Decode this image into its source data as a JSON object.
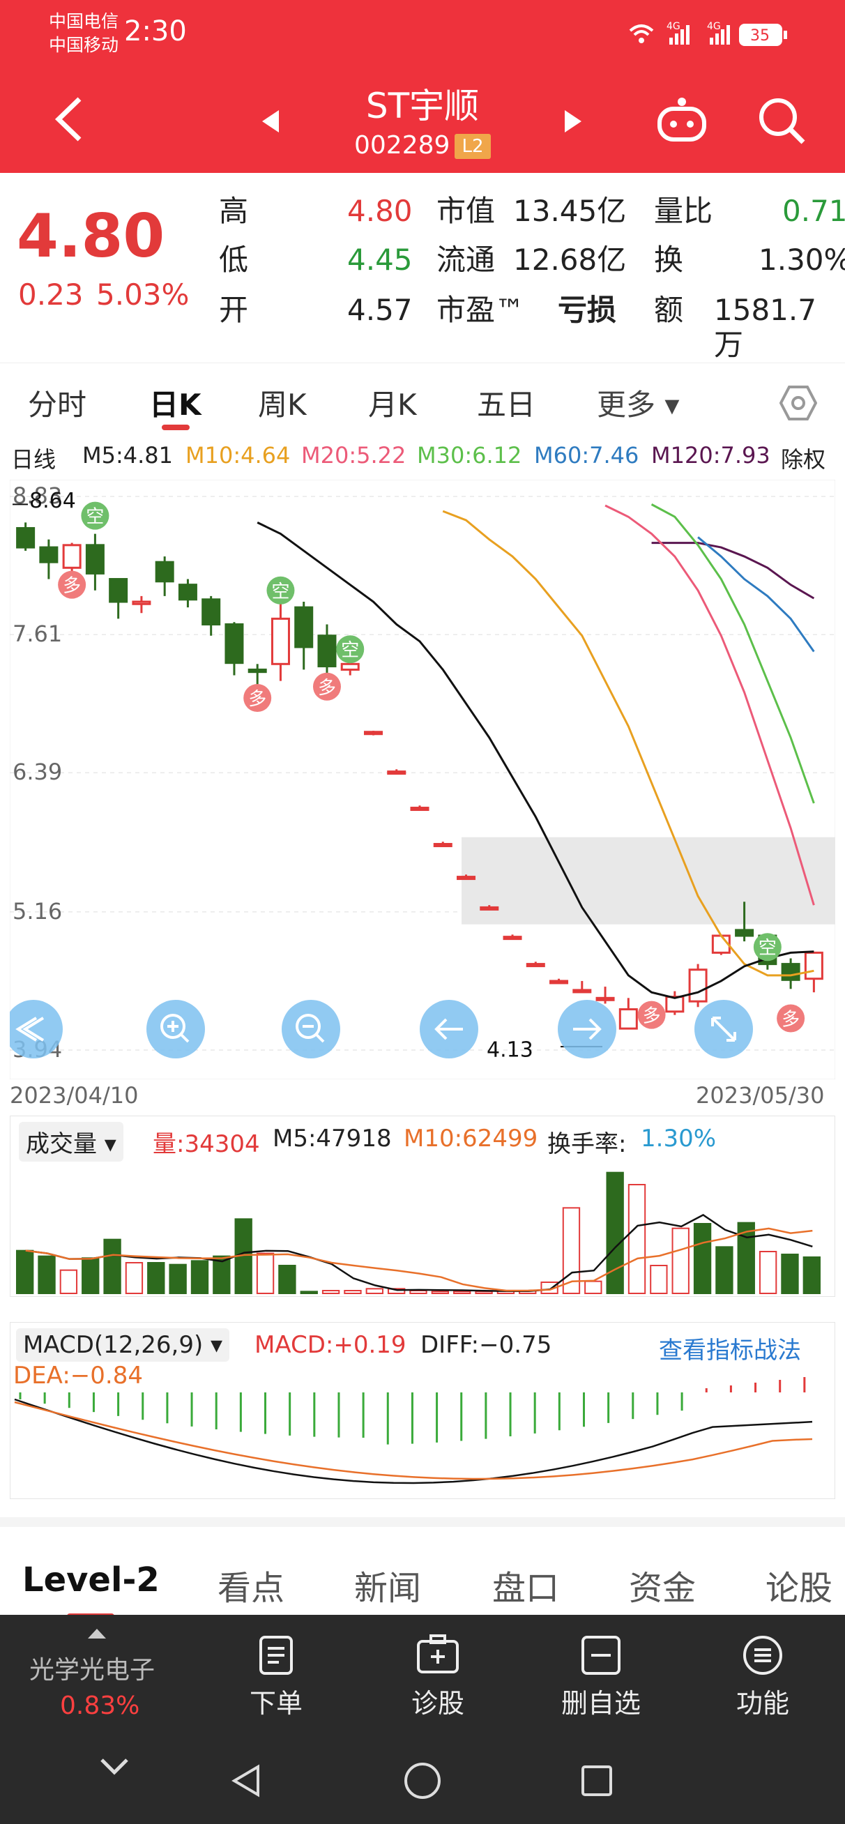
{
  "status": {
    "carrier1": "中国电信",
    "carrier2": "中国移动",
    "time": "2:30",
    "battery": "35",
    "net1": "4G",
    "net2": "4G"
  },
  "header": {
    "title": "ST宇顺",
    "code": "002289",
    "badge": "L2"
  },
  "quote": {
    "price": "4.80",
    "change": "0.23",
    "change_pct": "5.03%",
    "high_label": "高",
    "high": "4.80",
    "low_label": "低",
    "low": "4.45",
    "open_label": "开",
    "open": "4.57",
    "mcap_label": "市值",
    "mcap": "13.45亿",
    "float_label": "流通",
    "float": "12.68亿",
    "pe_label": "市盈™",
    "pe": "亏损",
    "ratio_label": "量比",
    "ratio": "0.71",
    "turn_label": "换",
    "turn": "1.30%",
    "amt_label": "额",
    "amt": "1581.7万"
  },
  "tabs": [
    "分时",
    "日K",
    "周K",
    "月K",
    "五日",
    "更多 ▾"
  ],
  "ma": {
    "line": "日线",
    "m5": "M5:4.81",
    "m10": "M10:4.64",
    "m20": "M20:5.22",
    "m30": "M30:6.12",
    "m60": "M60:7.46",
    "m120": "M120:7.93",
    "adj": "除权"
  },
  "colors": {
    "up": "#e23a3a",
    "down": "#2d6a1e",
    "m5": "#111111",
    "m10": "#e8a020",
    "m20": "#ec5a78",
    "m30": "#5cbf4a",
    "m60": "#2e7bc0",
    "m120": "#5a1650"
  },
  "kchart": {
    "y_ticks": [
      "8.83",
      "7.61",
      "6.39",
      "5.16",
      "3.94"
    ],
    "max_label": "8.64",
    "min_label": "4.13",
    "start_date": "2023/04/10",
    "end_date": "2023/05/30"
  },
  "chart_data": {
    "type": "candlestick",
    "ylim": [
      3.94,
      8.83
    ],
    "candles": [
      [
        8.55,
        8.38,
        8.6,
        8.35
      ],
      [
        8.38,
        8.25,
        8.45,
        8.1
      ],
      [
        8.2,
        8.4,
        8.42,
        8.15
      ],
      [
        8.4,
        8.15,
        8.5,
        8.0
      ],
      [
        8.1,
        7.9,
        8.1,
        7.75
      ],
      [
        7.88,
        7.9,
        7.95,
        7.8
      ],
      [
        8.25,
        8.08,
        8.3,
        7.95
      ],
      [
        8.05,
        7.92,
        8.1,
        7.85
      ],
      [
        7.92,
        7.7,
        7.95,
        7.6
      ],
      [
        7.7,
        7.36,
        7.72,
        7.25
      ],
      [
        7.3,
        7.28,
        7.35,
        7.15
      ],
      [
        7.35,
        7.75,
        7.9,
        7.2
      ],
      [
        7.85,
        7.5,
        7.9,
        7.3
      ],
      [
        7.6,
        7.33,
        7.7,
        7.2
      ],
      [
        7.3,
        7.35,
        7.4,
        7.25
      ],
      [
        6.75,
        6.75,
        6.76,
        6.72
      ],
      [
        6.4,
        6.4,
        6.42,
        6.38
      ],
      [
        6.08,
        6.08,
        6.1,
        6.06
      ],
      [
        5.76,
        5.76,
        5.78,
        5.74
      ],
      [
        5.47,
        5.47,
        5.49,
        5.45
      ],
      [
        5.2,
        5.2,
        5.22,
        5.18
      ],
      [
        4.94,
        4.94,
        4.96,
        4.92
      ],
      [
        4.7,
        4.7,
        4.72,
        4.68
      ],
      [
        4.55,
        4.55,
        4.57,
        4.53
      ],
      [
        4.47,
        4.47,
        4.55,
        4.45
      ],
      [
        4.4,
        4.4,
        4.5,
        4.35
      ],
      [
        4.13,
        4.3,
        4.4,
        4.13
      ],
      [
        4.28,
        4.2,
        4.36,
        4.15
      ],
      [
        4.28,
        4.41,
        4.46,
        4.25
      ],
      [
        4.37,
        4.65,
        4.7,
        4.32
      ],
      [
        4.8,
        4.95,
        4.95,
        4.78
      ],
      [
        5.0,
        4.95,
        5.25,
        4.9
      ],
      [
        4.95,
        4.7,
        4.95,
        4.65
      ],
      [
        4.7,
        4.56,
        4.75,
        4.48
      ],
      [
        4.57,
        4.8,
        4.8,
        4.45
      ]
    ],
    "ma5": [
      8.6,
      8.5,
      8.35,
      8.2,
      8.05,
      7.9,
      7.7,
      7.55,
      7.3,
      7.0,
      6.7,
      6.35,
      6.0,
      5.6,
      5.2,
      4.9,
      4.6,
      4.45,
      4.4,
      4.45,
      4.55,
      4.68,
      4.75,
      4.8,
      4.81
    ],
    "ma10": [
      8.7,
      8.62,
      8.45,
      8.3,
      8.1,
      7.85,
      7.6,
      7.2,
      6.8,
      6.3,
      5.8,
      5.3,
      4.95,
      4.7,
      4.6,
      4.6,
      4.64
    ],
    "ma20": [
      8.75,
      8.65,
      8.5,
      8.3,
      8.0,
      7.6,
      7.1,
      6.5,
      5.9,
      5.22
    ],
    "ma30": [
      8.76,
      8.65,
      8.4,
      8.1,
      7.7,
      7.2,
      6.7,
      6.12
    ],
    "ma60": [
      8.47,
      8.3,
      8.1,
      7.95,
      7.75,
      7.46
    ],
    "ma120": [
      8.42,
      8.42,
      8.42,
      8.38,
      8.3,
      8.2,
      8.05,
      7.93
    ],
    "volume": {
      "vol": "34304",
      "m5": "47918",
      "m10": "62499",
      "turnover": "1.30%",
      "bars": [
        46,
        40,
        25,
        38,
        58,
        33,
        33,
        31,
        35,
        40,
        80,
        43,
        30,
        2,
        3,
        3,
        5,
        5,
        3,
        2,
        2,
        2,
        3,
        3,
        12,
        92,
        13,
        130,
        117,
        30,
        70,
        75,
        50,
        76,
        45,
        42,
        39
      ]
    },
    "macd": {
      "label": "MACD(12,26,9)",
      "macd": "+0.19",
      "diff": "-0.75",
      "dea": "-0.84"
    }
  },
  "vol_labels": {
    "select": "成交量 ▾",
    "vol": "量:34304",
    "m5": "M5:47918",
    "m10": "M10:62499",
    "turn_label": "换手率:",
    "turn": "1.30%"
  },
  "macd_labels": {
    "select": "MACD(12,26,9) ▾",
    "macd": "MACD:+0.19",
    "diff": "DIFF:−0.75",
    "dea": "DEA:−0.84",
    "link": "查看指标战法"
  },
  "bottom_tabs": [
    "Level-2",
    "看点",
    "新闻",
    "盘口",
    "资金",
    "论股"
  ],
  "bottom_bar": {
    "sector": "光学光电子",
    "sector_pct": "0.83%",
    "order": "下单",
    "diagnose": "诊股",
    "remove": "删自选",
    "func": "功能"
  },
  "markers": {
    "kong": "空",
    "duo": "多"
  }
}
